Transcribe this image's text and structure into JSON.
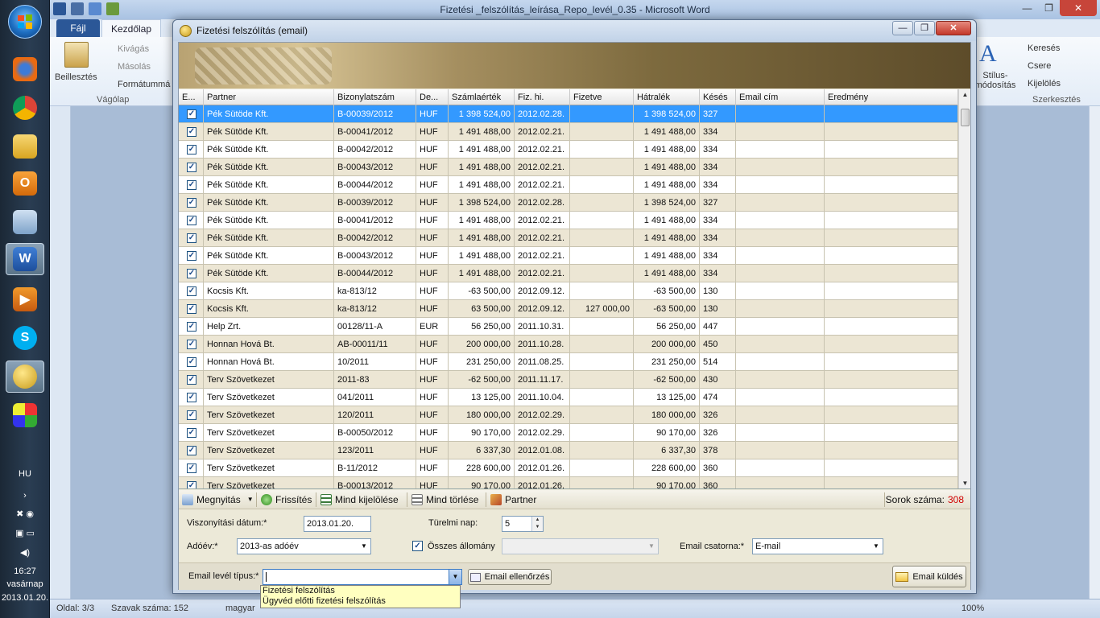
{
  "taskbar": {
    "language": "HU",
    "clock_time": "16:27",
    "clock_day": "vasárnap",
    "clock_date": "2013.01.20."
  },
  "word": {
    "window_title": "Fizetési _felszólítás_leírása_Repo_levél_0.35 - Microsoft Word",
    "tab_file": "Fájl",
    "tab_home": "Kezdőlap",
    "paste_label": "Beillesztés",
    "cut_label": "Kivágás",
    "copy_label": "Másolás",
    "format_label": "Formátummásoló",
    "clipboard_group": "Vágólap",
    "styles_label": "Stílus-módosítás",
    "find_label": "Keresés",
    "replace_label": "Csere",
    "select_label": "Kijelölés",
    "editing_group": "Szerkesztés",
    "status_page": "Oldal: 3/3",
    "status_words": "Szavak száma: 152",
    "status_lang": "magyar",
    "zoom": "100%"
  },
  "dialog": {
    "title": "Fizetési felszólítás (email)",
    "columns": [
      "E...",
      "Partner",
      "Bizonylatszám",
      "De...",
      "Számlaérték",
      "Fiz. hi.",
      "Fizetve",
      "Hátralék",
      "Késés",
      "Email cím",
      "Eredmény"
    ],
    "rows": [
      {
        "checked": true,
        "partner": "Pék Sütöde Kft.",
        "doc": "B-00039/2012",
        "cur": "HUF",
        "amount": "1 398 524,00",
        "due": "2012.02.28.",
        "paid": "",
        "remaining": "1 398 524,00",
        "late": "327",
        "email": "",
        "result": ""
      },
      {
        "checked": true,
        "partner": "Pék Sütöde Kft.",
        "doc": "B-00041/2012",
        "cur": "HUF",
        "amount": "1 491 488,00",
        "due": "2012.02.21.",
        "paid": "",
        "remaining": "1 491 488,00",
        "late": "334",
        "email": "",
        "result": ""
      },
      {
        "checked": true,
        "partner": "Pék Sütöde Kft.",
        "doc": "B-00042/2012",
        "cur": "HUF",
        "amount": "1 491 488,00",
        "due": "2012.02.21.",
        "paid": "",
        "remaining": "1 491 488,00",
        "late": "334",
        "email": "",
        "result": ""
      },
      {
        "checked": true,
        "partner": "Pék Sütöde Kft.",
        "doc": "B-00043/2012",
        "cur": "HUF",
        "amount": "1 491 488,00",
        "due": "2012.02.21.",
        "paid": "",
        "remaining": "1 491 488,00",
        "late": "334",
        "email": "",
        "result": ""
      },
      {
        "checked": true,
        "partner": "Pék Sütöde Kft.",
        "doc": "B-00044/2012",
        "cur": "HUF",
        "amount": "1 491 488,00",
        "due": "2012.02.21.",
        "paid": "",
        "remaining": "1 491 488,00",
        "late": "334",
        "email": "",
        "result": ""
      },
      {
        "checked": true,
        "partner": "Pék Sütöde Kft.",
        "doc": "B-00039/2012",
        "cur": "HUF",
        "amount": "1 398 524,00",
        "due": "2012.02.28.",
        "paid": "",
        "remaining": "1 398 524,00",
        "late": "327",
        "email": "",
        "result": ""
      },
      {
        "checked": true,
        "partner": "Pék Sütöde Kft.",
        "doc": "B-00041/2012",
        "cur": "HUF",
        "amount": "1 491 488,00",
        "due": "2012.02.21.",
        "paid": "",
        "remaining": "1 491 488,00",
        "late": "334",
        "email": "",
        "result": ""
      },
      {
        "checked": true,
        "partner": "Pék Sütöde Kft.",
        "doc": "B-00042/2012",
        "cur": "HUF",
        "amount": "1 491 488,00",
        "due": "2012.02.21.",
        "paid": "",
        "remaining": "1 491 488,00",
        "late": "334",
        "email": "",
        "result": ""
      },
      {
        "checked": true,
        "partner": "Pék Sütöde Kft.",
        "doc": "B-00043/2012",
        "cur": "HUF",
        "amount": "1 491 488,00",
        "due": "2012.02.21.",
        "paid": "",
        "remaining": "1 491 488,00",
        "late": "334",
        "email": "",
        "result": ""
      },
      {
        "checked": true,
        "partner": "Pék Sütöde Kft.",
        "doc": "B-00044/2012",
        "cur": "HUF",
        "amount": "1 491 488,00",
        "due": "2012.02.21.",
        "paid": "",
        "remaining": "1 491 488,00",
        "late": "334",
        "email": "",
        "result": ""
      },
      {
        "checked": true,
        "partner": "Kocsis Kft.",
        "doc": "ka-813/12",
        "cur": "HUF",
        "amount": "-63 500,00",
        "due": "2012.09.12.",
        "paid": "",
        "remaining": "-63 500,00",
        "late": "130",
        "email": "",
        "result": ""
      },
      {
        "checked": true,
        "partner": "Kocsis Kft.",
        "doc": "ka-813/12",
        "cur": "HUF",
        "amount": "63 500,00",
        "due": "2012.09.12.",
        "paid": "127 000,00",
        "remaining": "-63 500,00",
        "late": "130",
        "email": "",
        "result": ""
      },
      {
        "checked": true,
        "partner": "Help Zrt.",
        "doc": "00128/11-A",
        "cur": "EUR",
        "amount": "56 250,00",
        "due": "2011.10.31.",
        "paid": "",
        "remaining": "56 250,00",
        "late": "447",
        "email": "",
        "result": ""
      },
      {
        "checked": true,
        "partner": "Honnan Hová Bt.",
        "doc": "AB-00011/11",
        "cur": "HUF",
        "amount": "200 000,00",
        "due": "2011.10.28.",
        "paid": "",
        "remaining": "200 000,00",
        "late": "450",
        "email": "",
        "result": ""
      },
      {
        "checked": true,
        "partner": "Honnan Hová Bt.",
        "doc": "10/2011",
        "cur": "HUF",
        "amount": "231 250,00",
        "due": "2011.08.25.",
        "paid": "",
        "remaining": "231 250,00",
        "late": "514",
        "email": "",
        "result": ""
      },
      {
        "checked": true,
        "partner": "Terv Szövetkezet",
        "doc": "2011-83",
        "cur": "HUF",
        "amount": "-62 500,00",
        "due": "2011.11.17.",
        "paid": "",
        "remaining": "-62 500,00",
        "late": "430",
        "email": "",
        "result": ""
      },
      {
        "checked": true,
        "partner": "Terv Szövetkezet",
        "doc": "041/2011",
        "cur": "HUF",
        "amount": "13 125,00",
        "due": "2011.10.04.",
        "paid": "",
        "remaining": "13 125,00",
        "late": "474",
        "email": "",
        "result": ""
      },
      {
        "checked": true,
        "partner": "Terv Szövetkezet",
        "doc": "120/2011",
        "cur": "HUF",
        "amount": "180 000,00",
        "due": "2012.02.29.",
        "paid": "",
        "remaining": "180 000,00",
        "late": "326",
        "email": "",
        "result": ""
      },
      {
        "checked": true,
        "partner": "Terv Szövetkezet",
        "doc": "B-00050/2012",
        "cur": "HUF",
        "amount": "90 170,00",
        "due": "2012.02.29.",
        "paid": "",
        "remaining": "90 170,00",
        "late": "326",
        "email": "",
        "result": ""
      },
      {
        "checked": true,
        "partner": "Terv Szövetkezet",
        "doc": "123/2011",
        "cur": "HUF",
        "amount": "6 337,30",
        "due": "2012.01.08.",
        "paid": "",
        "remaining": "6 337,30",
        "late": "378",
        "email": "",
        "result": ""
      },
      {
        "checked": true,
        "partner": "Terv Szövetkezet",
        "doc": "B-11/2012",
        "cur": "HUF",
        "amount": "228 600,00",
        "due": "2012.01.26.",
        "paid": "",
        "remaining": "228 600,00",
        "late": "360",
        "email": "",
        "result": ""
      },
      {
        "checked": true,
        "partner": "Terv Szövetkezet",
        "doc": "B-00013/2012",
        "cur": "HUF",
        "amount": "90 170,00",
        "due": "2012.01.26.",
        "paid": "",
        "remaining": "90 170,00",
        "late": "360",
        "email": "",
        "result": ""
      }
    ],
    "toolbar": {
      "open": "Megnyitás",
      "refresh": "Frissítés",
      "select_all": "Mind kijelölése",
      "clear_all": "Mind törlése",
      "partner": "Partner",
      "row_count_label": "Sorok száma:",
      "row_count": "308"
    },
    "form": {
      "reference_date_label": "Viszonyítási dátum:*",
      "reference_date": "2013.01.20.",
      "grace_days_label": "Türelmi nap:",
      "grace_days": "5",
      "tax_year_label": "Adóév:*",
      "tax_year": "2013-as adóév",
      "all_files_label": "Összes állomány",
      "email_channel_label": "Email csatorna:*",
      "email_channel": "E-mail",
      "letter_type_label": "Email levél típus:*",
      "letter_type_value": "",
      "check_email_button": "Email ellenőrzés",
      "send_email_button": "Email küldés"
    },
    "letter_type_options": [
      "Fizetési felszólítás",
      "Ügyvéd előtti fizetési felszólítás"
    ]
  }
}
